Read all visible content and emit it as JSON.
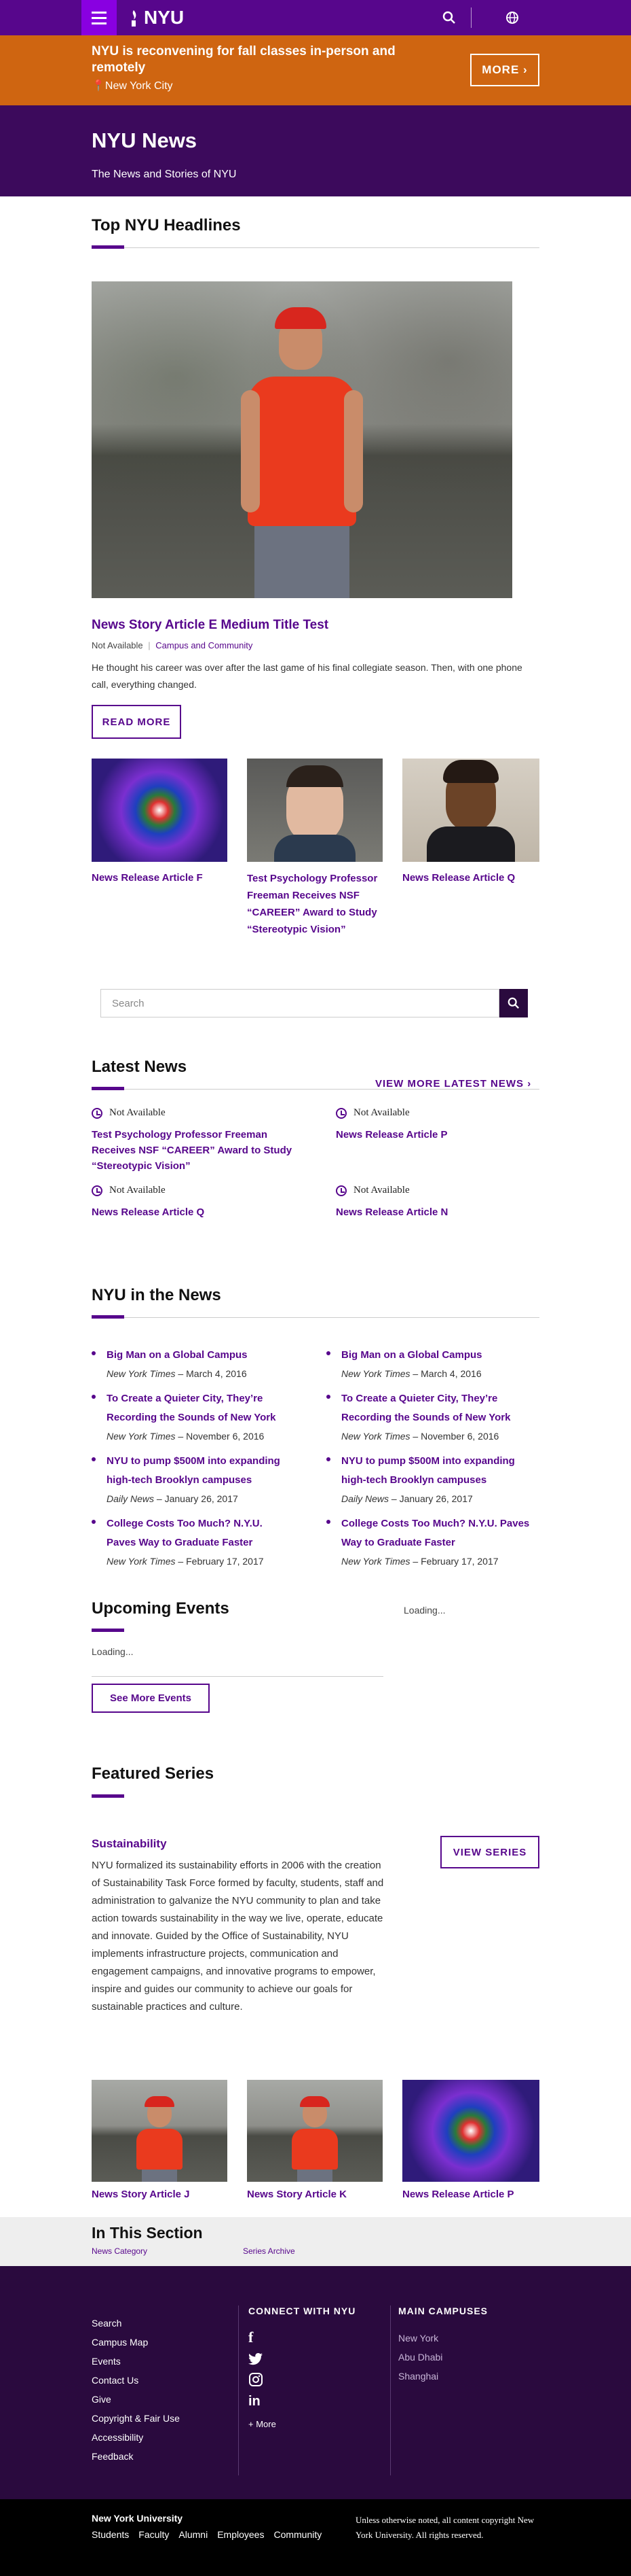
{
  "header": {
    "logo": "NYU"
  },
  "alert": {
    "title": "NYU is reconvening for fall classes in-person and remotely",
    "location": "New York City",
    "more": "MORE"
  },
  "hero": {
    "title": "NYU News",
    "subtitle": "The News and Stories of NYU"
  },
  "headlines": {
    "heading": "Top NYU Headlines",
    "featured": {
      "title": "News Story Article E Medium Title Test",
      "status": "Not Available",
      "category": "Campus and Community",
      "summary": "He thought his career was over after the last game of his final collegiate season. Then, with one phone call, everything changed.",
      "button": "READ MORE"
    },
    "cards": [
      {
        "title": "News Release Article F"
      },
      {
        "title": "Test Psychology Professor Freeman Receives NSF “CAREER” Award to Study “Stereotypic Vision”"
      },
      {
        "title": "News Release Article Q"
      }
    ]
  },
  "search": {
    "placeholder": "Search"
  },
  "latest": {
    "heading": "Latest News",
    "view_more": "VIEW MORE LATEST NEWS",
    "items": [
      {
        "status": "Not Available",
        "title": "Test Psychology Professor Freeman Receives NSF “CAREER” Award to Study “Stereotypic Vision”"
      },
      {
        "status": "Not Available",
        "title": "News Release Article P"
      },
      {
        "status": "Not Available",
        "title": "News Release Article Q"
      },
      {
        "status": "Not Available",
        "title": "News Release Article N"
      }
    ]
  },
  "inthenews": {
    "heading": "NYU in the News",
    "col1": [
      {
        "title": "Big Man on a Global Campus",
        "source": "New York Times",
        "date": "March 4, 2016"
      },
      {
        "title": "To Create a Quieter City, They’re Recording the Sounds of New York",
        "source": "New York Times",
        "date": "November 6, 2016"
      },
      {
        "title": "NYU to pump $500M into expanding high-tech Brooklyn campuses",
        "source": "Daily News",
        "date": "January 26, 2017"
      },
      {
        "title": "College Costs Too Much? N.Y.U. Paves Way to Graduate Faster",
        "source": "New York Times",
        "date": "February 17, 2017"
      }
    ],
    "col2": [
      {
        "title": "Big Man on a Global Campus",
        "source": "New York Times",
        "date": "March 4, 2016"
      },
      {
        "title": "To Create a Quieter City, They’re Recording the Sounds of New York",
        "source": "New York Times",
        "date": "November 6, 2016"
      },
      {
        "title": "NYU to pump $500M into expanding high-tech Brooklyn campuses",
        "source": "Daily News",
        "date": "January 26, 2017"
      },
      {
        "title": "College Costs Too Much? N.Y.U. Paves Way to Graduate Faster",
        "source": "New York Times",
        "date": "February 17, 2017"
      }
    ]
  },
  "events": {
    "heading": "Upcoming Events",
    "loading": "Loading...",
    "loading2": "Loading...",
    "button": "See More Events"
  },
  "featured": {
    "heading": "Featured Series",
    "series_title": "Sustainability",
    "view": "VIEW SERIES",
    "body": "NYU formalized its sustainability efforts in 2006 with the creation of Sustainability Task Force formed by faculty, students, staff and administration to galvanize the NYU community to plan and take action towards sustainability in the way we live, operate, educate and innovate. Guided by the Office of Sustainability, NYU implements infrastructure projects, communication and engagement campaigns, and innovative programs to empower, inspire and guides our community to achieve our goals for sustainable practices and culture.",
    "cards": [
      {
        "title": "News Story Article J"
      },
      {
        "title": "News Story Article K"
      },
      {
        "title": "News Release Article P"
      }
    ]
  },
  "insection": {
    "heading": "In This Section",
    "links": [
      "News Category",
      "Series Archive"
    ]
  },
  "footer": {
    "links": [
      "Search",
      "Campus Map",
      "Events",
      "Contact Us",
      "Give",
      "Copyright & Fair Use",
      "Accessibility",
      "Feedback"
    ],
    "connect_heading": "CONNECT WITH NYU",
    "more": "+ More",
    "campus_heading": "MAIN CAMPUSES",
    "campuses": [
      "New York",
      "Abu Dhabi",
      "Shanghai"
    ],
    "university": "New York University",
    "audiences": [
      "Students",
      "Faculty",
      "Alumni",
      "Employees",
      "Community"
    ],
    "copyright": "Unless otherwise noted, all content copyright New York University. All rights reserved."
  }
}
